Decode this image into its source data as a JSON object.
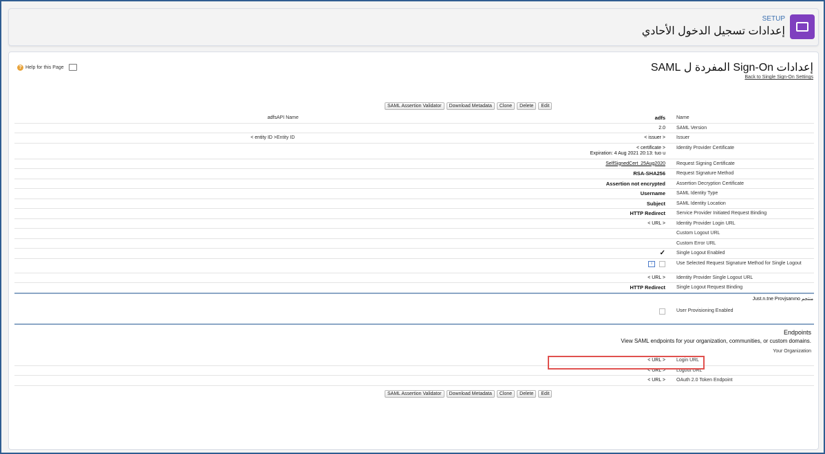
{
  "header": {
    "eyebrow": "SETUP",
    "title": "إعدادات تسجيل الدخول الأحادي"
  },
  "page": {
    "title": "إعدادات Sign-On المفردة ل SAML",
    "back_link": "Back to Single Sign-On Settings",
    "help_link": "Help for this Page"
  },
  "buttons": {
    "edit": "Edit",
    "delete": "Delete",
    "clone": "Clone",
    "download_metadata": "Download Metadata",
    "saml_validator": "SAML Assertion Validator"
  },
  "details": {
    "name_label": "Name",
    "name_value": "adfs",
    "api_name_label": "API Name",
    "api_name_value": "adfs",
    "saml_version_label": "SAML Version",
    "saml_version_value": "2.0",
    "issuer_label": "Issuer",
    "issuer_value": "< issuer >",
    "entity_id_label": "Entity ID",
    "entity_id_value": "< entity ID >",
    "idp_cert_label": "Identity Provider Certificate",
    "idp_cert_value": "< certificate >",
    "idp_cert_expiration": "Expiration: 4 Aug 2021 20:13: tuo u",
    "req_sign_cert_label": "Request Signing Certificate",
    "req_sign_cert_value": "SelfSignedCert_25Aug2020",
    "req_sig_method_label": "Request Signature Method",
    "req_sig_method_value": "RSA-SHA256",
    "assertion_decrypt_label": "Assertion Decryption Certificate",
    "assertion_decrypt_value": "Assertion not encrypted",
    "identity_type_label": "SAML Identity Type",
    "identity_type_value": "Username",
    "identity_location_label": "SAML Identity Location",
    "identity_location_value": "Subject",
    "sp_binding_label": "Service Provider Initiated Request Binding",
    "sp_binding_value": "HTTP Redirect",
    "idp_login_label": "Identity Provider Login URL",
    "idp_login_value": "< URL >",
    "custom_logout_label": "Custom Logout URL",
    "custom_error_label": "Custom Error URL",
    "single_logout_enabled_label": "Single Logout Enabled",
    "single_logout_enabled_value": "✓",
    "use_selected_label": "Use Selected Request Signature Method for Single Logout",
    "idp_single_logout_label": "Identity Provider Single Logout URL",
    "idp_single_logout_value": "< URL >",
    "single_logout_binding_label": "Single Logout Request Binding",
    "single_logout_binding_value": "HTTP Redirect"
  },
  "jit": {
    "section_label": "Just.n.tne Provjsanıno منتجم",
    "user_provisioning_label": "User Provisioning Enabled"
  },
  "endpoints": {
    "title": "Endpoints",
    "description": "View SAML endpoints for your organization, communities, or custom domains.",
    "your_org": "Your Organization",
    "login_label": "Login URL",
    "login_value": "< URL >",
    "logout_label": "Logout URL",
    "logout_value": "< URL >",
    "oauth_label": "OAuth 2.0 Token Endpoint",
    "oauth_value": "< URL >"
  }
}
